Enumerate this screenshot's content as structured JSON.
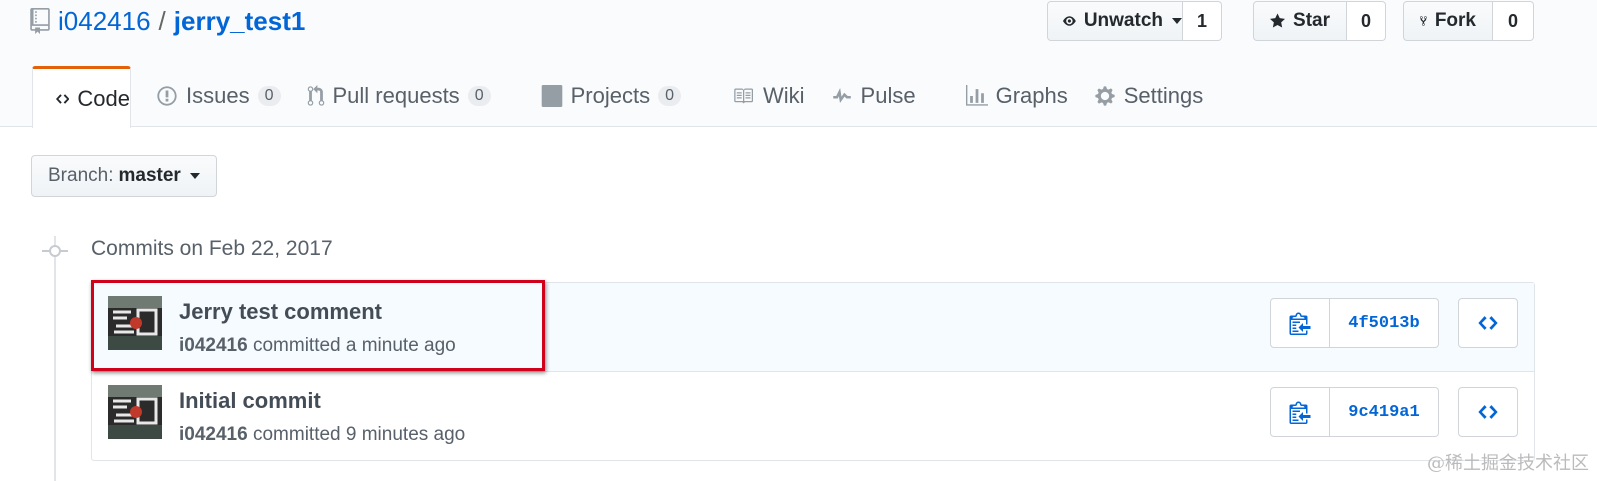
{
  "repo": {
    "owner": "i042416",
    "separator": "/",
    "name": "jerry_test1"
  },
  "actions": {
    "watch": {
      "label": "Unwatch",
      "count": "1"
    },
    "star": {
      "label": "Star",
      "count": "0"
    },
    "fork": {
      "label": "Fork",
      "count": "0"
    }
  },
  "tabs": [
    {
      "label": "Code",
      "icon": "code-icon",
      "selected": true
    },
    {
      "label": "Issues",
      "count": "0",
      "icon": "issue-icon"
    },
    {
      "label": "Pull requests",
      "count": "0",
      "icon": "pull-request-icon"
    },
    {
      "label": "Projects",
      "count": "0",
      "icon": "project-icon"
    },
    {
      "label": "Wiki",
      "icon": "book-icon"
    },
    {
      "label": "Pulse",
      "icon": "pulse-icon"
    },
    {
      "label": "Graphs",
      "icon": "graph-icon"
    },
    {
      "label": "Settings",
      "icon": "gear-icon"
    }
  ],
  "branch": {
    "label": "Branch:",
    "value": "master"
  },
  "commits_header": "Commits on Feb 22, 2017",
  "commits": [
    {
      "message": "Jerry test comment",
      "author": "i042416",
      "time": "committed a minute ago",
      "sha": "4f5013b"
    },
    {
      "message": "Initial commit",
      "author": "i042416",
      "time": "committed 9 minutes ago",
      "sha": "9c419a1"
    }
  ],
  "watermark": "@稀土掘金技术社区",
  "colors": {
    "link": "#0366d6",
    "tab_accent": "#e36209",
    "highlight": "#d0021b"
  }
}
